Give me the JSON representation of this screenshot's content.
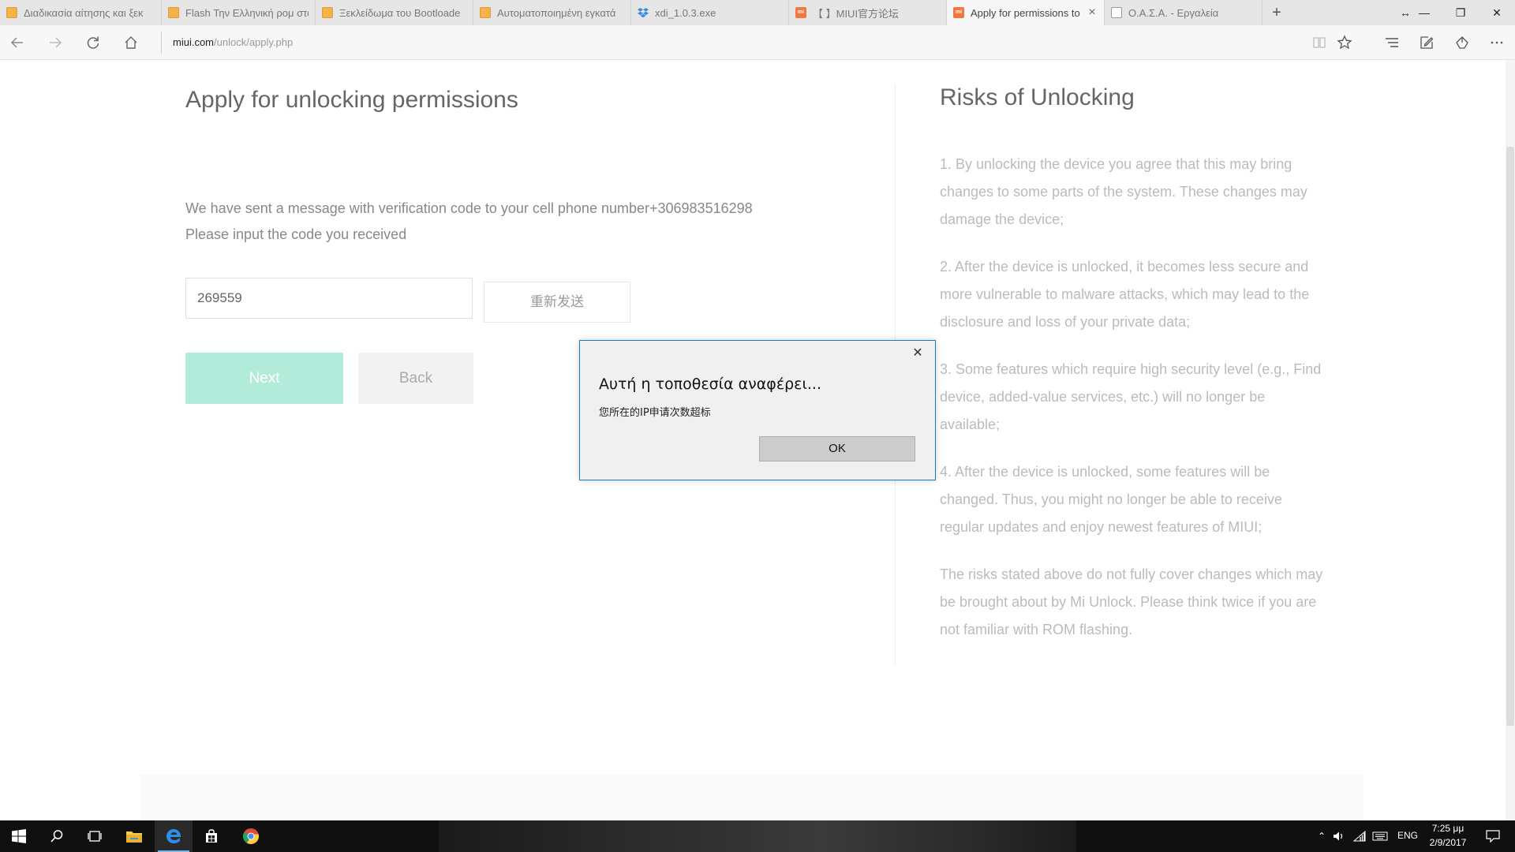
{
  "tabs": [
    {
      "title": "Διαδικασία αίτησης και ξεκ",
      "favicon": "orange-page-icon",
      "active": false
    },
    {
      "title": "Flash Την Ελληνική ρομ στο",
      "favicon": "orange-page-icon",
      "active": false
    },
    {
      "title": "Ξεκλείδωμα του Bootloade",
      "favicon": "orange-page-icon",
      "active": false
    },
    {
      "title": "Αυτοματοποιημένη εγκατά",
      "favicon": "orange-page-icon",
      "active": false
    },
    {
      "title": "xdi_1.0.3.exe",
      "favicon": "dropbox-icon",
      "active": false
    },
    {
      "title": "【        】MIUI官方论坛",
      "favicon": "mi-icon",
      "active": false
    },
    {
      "title": "Apply for permissions to",
      "favicon": "mi-icon",
      "active": true
    },
    {
      "title": "Ο.Α.Σ.Α. - Εργαλεία",
      "favicon": "page-icon",
      "active": false
    }
  ],
  "address": {
    "domain": "miui.com",
    "path": "/unlock/apply.php"
  },
  "page": {
    "title": "Apply for unlocking permissions",
    "message_line1": "We have sent a message with verification code to your cell phone number+306983516298",
    "message_line2": "Please input the code you received",
    "code_value": "269559",
    "resend_label": "重新发送",
    "next_label": "Next",
    "back_label": "Back"
  },
  "risks": {
    "title": "Risks of Unlocking",
    "items": [
      "1. By unlocking the device you agree that this may bring changes to some parts of the system. These changes may damage the device;",
      "2. After the device is unlocked, it becomes less secure and more vulnerable to malware attacks, which may lead to the disclosure and loss of your private data;",
      "3. Some features which require high security level (e.g., Find device, added-value services, etc.) will no longer be available;",
      "4. After the device is unlocked, some features will be changed. Thus, you might no longer be able to receive regular updates and enjoy newest features of MIUI;",
      "The risks stated above do not fully cover changes which may be brought about by Mi Unlock. Please think twice if you are not familiar with ROM flashing."
    ]
  },
  "dialog": {
    "title": "Αυτή η τοποθεσία αναφέρει...",
    "message": "您所在的IP申请次数超标",
    "ok_label": "OK"
  },
  "taskbar": {
    "language": "ENG",
    "time": "7:25 μμ",
    "date": "2/9/2017"
  },
  "colors": {
    "accent_next": "#b2ebd9",
    "dialog_border": "#1979ca",
    "edge_blue": "#1a73e8"
  }
}
